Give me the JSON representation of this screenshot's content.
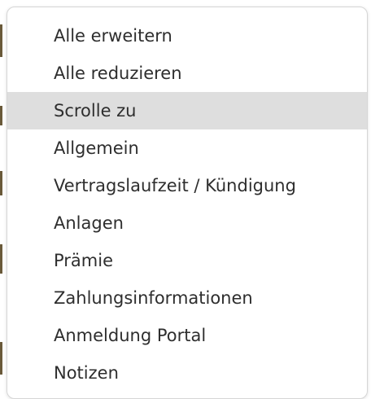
{
  "context_menu": {
    "items": [
      {
        "label": "Alle erweitern",
        "highlighted": false
      },
      {
        "label": "Alle reduzieren",
        "highlighted": false
      },
      {
        "label": "Scrolle zu",
        "highlighted": true
      },
      {
        "label": "Allgemein",
        "highlighted": false
      },
      {
        "label": "Vertragslaufzeit / Kündigung",
        "highlighted": false
      },
      {
        "label": "Anlagen",
        "highlighted": false
      },
      {
        "label": "Prämie",
        "highlighted": false
      },
      {
        "label": "Zahlungsinformationen",
        "highlighted": false
      },
      {
        "label": "Anmeldung Portal",
        "highlighted": false
      },
      {
        "label": "Notizen",
        "highlighted": false
      }
    ],
    "colors": {
      "background": "#ffffff",
      "highlight": "#dedede",
      "text": "#2e2e2e",
      "border": "#d6d6d6"
    }
  }
}
